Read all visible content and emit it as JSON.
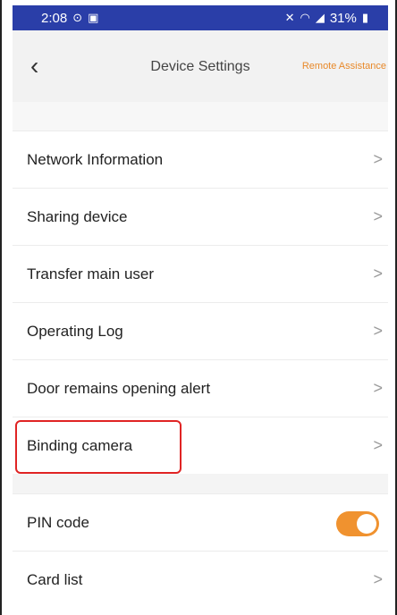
{
  "status_bar": {
    "time": "2:08",
    "left_icons": [
      "alarm-icon",
      "image-icon"
    ],
    "right_text": "31%",
    "right_icons": [
      "mute-icon",
      "wifi-icon",
      "signal-icon",
      "battery-icon"
    ]
  },
  "header": {
    "title": "Device Settings",
    "back_icon": "back-chevron-icon",
    "remote_assistance": "Remote Assistance",
    "accent_color": "#e8892a"
  },
  "settings_group_1": [
    {
      "label": "Network Information",
      "chevron": "chevron-right-icon"
    },
    {
      "label": "Sharing device",
      "chevron": "chevron-right-icon"
    },
    {
      "label": "Transfer main user",
      "chevron": "chevron-right-icon"
    },
    {
      "label": "Operating Log",
      "chevron": "chevron-right-icon"
    },
    {
      "label": "Door remains opening alert",
      "chevron": "chevron-right-icon"
    },
    {
      "label": "Binding camera",
      "chevron": "chevron-right-icon",
      "highlighted": true
    }
  ],
  "settings_group_2": [
    {
      "label": "PIN code",
      "toggle": true,
      "toggle_on": true,
      "toggle_color": "#f0922f"
    },
    {
      "label": "Card list",
      "chevron": "chevron-right-icon"
    }
  ],
  "highlight_color": "#e02424"
}
